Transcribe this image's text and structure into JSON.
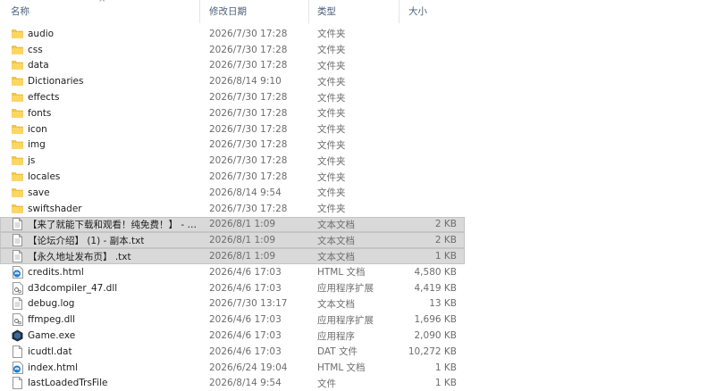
{
  "columns": {
    "name": "名称",
    "date": "修改日期",
    "type": "类型",
    "size": "大小",
    "sort_indicator": "^"
  },
  "colors": {
    "folder": "#f5c543",
    "selection": "#d9d9d9",
    "header_text": "#4c607a",
    "html_icon": "#1a7fd4"
  },
  "files": [
    {
      "name": "audio",
      "date": "2026/7/30 17:28",
      "type": "文件夹",
      "size": "",
      "icon": "folder-icon",
      "selected": false
    },
    {
      "name": "css",
      "date": "2026/7/30 17:28",
      "type": "文件夹",
      "size": "",
      "icon": "folder-icon",
      "selected": false
    },
    {
      "name": "data",
      "date": "2026/7/30 17:28",
      "type": "文件夹",
      "size": "",
      "icon": "folder-icon",
      "selected": false
    },
    {
      "name": "Dictionaries",
      "date": "2026/8/14 9:10",
      "type": "文件夹",
      "size": "",
      "icon": "folder-icon",
      "selected": false
    },
    {
      "name": "effects",
      "date": "2026/7/30 17:28",
      "type": "文件夹",
      "size": "",
      "icon": "folder-icon",
      "selected": false
    },
    {
      "name": "fonts",
      "date": "2026/7/30 17:28",
      "type": "文件夹",
      "size": "",
      "icon": "folder-icon",
      "selected": false
    },
    {
      "name": "icon",
      "date": "2026/7/30 17:28",
      "type": "文件夹",
      "size": "",
      "icon": "folder-icon",
      "selected": false
    },
    {
      "name": "img",
      "date": "2026/7/30 17:28",
      "type": "文件夹",
      "size": "",
      "icon": "folder-icon",
      "selected": false
    },
    {
      "name": "js",
      "date": "2026/7/30 17:28",
      "type": "文件夹",
      "size": "",
      "icon": "folder-icon",
      "selected": false
    },
    {
      "name": "locales",
      "date": "2026/7/30 17:28",
      "type": "文件夹",
      "size": "",
      "icon": "folder-icon",
      "selected": false
    },
    {
      "name": "save",
      "date": "2026/8/14 9:54",
      "type": "文件夹",
      "size": "",
      "icon": "folder-icon",
      "selected": false
    },
    {
      "name": "swiftshader",
      "date": "2026/7/30 17:28",
      "type": "文件夹",
      "size": "",
      "icon": "folder-icon",
      "selected": false
    },
    {
      "name": "【来了就能下载和观看！纯免费！】 - 副...",
      "date": "2026/8/1 1:09",
      "type": "文本文档",
      "size": "2 KB",
      "icon": "text-file-icon",
      "selected": true
    },
    {
      "name": "【论坛介绍】 (1) - 副本.txt",
      "date": "2026/8/1 1:09",
      "type": "文本文档",
      "size": "2 KB",
      "icon": "text-file-icon",
      "selected": true
    },
    {
      "name": "【永久地址发布页】 .txt",
      "date": "2026/8/1 1:09",
      "type": "文本文档",
      "size": "1 KB",
      "icon": "text-file-icon",
      "selected": true
    },
    {
      "name": "credits.html",
      "date": "2026/4/6 17:03",
      "type": "HTML 文档",
      "size": "4,580 KB",
      "icon": "html-file-icon",
      "selected": false
    },
    {
      "name": "d3dcompiler_47.dll",
      "date": "2026/4/6 17:03",
      "type": "应用程序扩展",
      "size": "4,419 KB",
      "icon": "dll-file-icon",
      "selected": false
    },
    {
      "name": "debug.log",
      "date": "2026/7/30 13:17",
      "type": "文本文档",
      "size": "13 KB",
      "icon": "text-file-icon",
      "selected": false
    },
    {
      "name": "ffmpeg.dll",
      "date": "2026/4/6 17:03",
      "type": "应用程序扩展",
      "size": "1,696 KB",
      "icon": "dll-file-icon",
      "selected": false
    },
    {
      "name": "Game.exe",
      "date": "2026/4/6 17:03",
      "type": "应用程序",
      "size": "2,090 KB",
      "icon": "exe-game-icon",
      "selected": false
    },
    {
      "name": "icudtl.dat",
      "date": "2026/4/6 17:03",
      "type": "DAT 文件",
      "size": "10,272 KB",
      "icon": "blank-file-icon",
      "selected": false
    },
    {
      "name": "index.html",
      "date": "2026/6/24 19:04",
      "type": "HTML 文档",
      "size": "1 KB",
      "icon": "html-file-icon",
      "selected": false
    },
    {
      "name": "lastLoadedTrsFile",
      "date": "2026/8/14 9:54",
      "type": "文件",
      "size": "1 KB",
      "icon": "blank-file-icon",
      "selected": false
    }
  ]
}
